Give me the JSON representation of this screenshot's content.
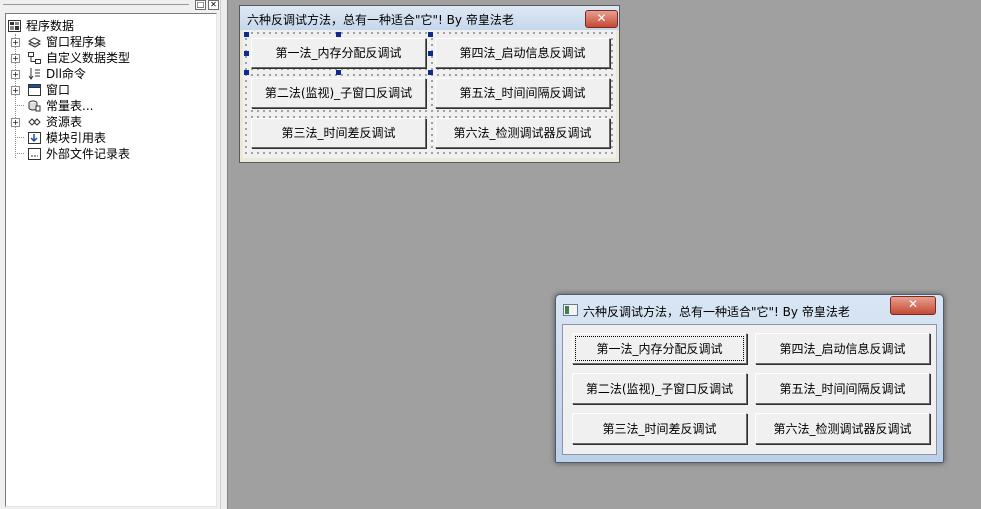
{
  "tree": {
    "root": "程序数据",
    "items": [
      {
        "label": "窗口程序集",
        "icon": "assembly-icon",
        "expandable": true
      },
      {
        "label": "自定义数据类型",
        "icon": "datatype-icon",
        "expandable": true
      },
      {
        "label": "Dll命令",
        "icon": "dll-command-icon",
        "expandable": true
      },
      {
        "label": "窗口",
        "icon": "window-icon",
        "expandable": true
      },
      {
        "label": "常量表...",
        "icon": "constant-table-icon",
        "expandable": false
      },
      {
        "label": "资源表",
        "icon": "resource-icon",
        "expandable": true
      },
      {
        "label": "模块引用表",
        "icon": "module-ref-icon",
        "expandable": false
      },
      {
        "label": "外部文件记录表",
        "icon": "file-record-icon",
        "expandable": false
      }
    ]
  },
  "panel": {
    "restore_glyph": "□",
    "close_glyph": "✕"
  },
  "design_form": {
    "title": "六种反调试方法，总有一种适合\"它\"! By 帝皇法老",
    "close_glyph": "✕",
    "buttons": [
      "第一法_内存分配反调试",
      "第四法_启动信息反调试",
      "第二法(监视)_子窗口反调试",
      "第五法_时间间隔反调试",
      "第三法_时间差反调试",
      "第六法_检测调试器反调试"
    ]
  },
  "run_window": {
    "title": "六种反调试方法，总有一种适合\"它\"! By 帝皇法老",
    "close_glyph": "✕",
    "buttons": [
      "第一法_内存分配反调试",
      "第四法_启动信息反调试",
      "第二法(监视)_子窗口反调试",
      "第五法_时间间隔反调试",
      "第三法_时间差反调试",
      "第六法_检测调试器反调试"
    ]
  }
}
